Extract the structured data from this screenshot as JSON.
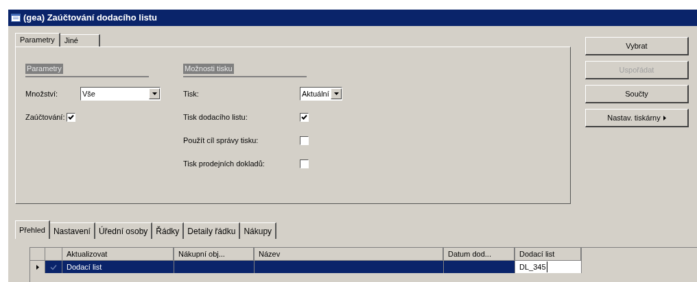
{
  "window": {
    "title": "(gea) Zaúčtování dodacího listu"
  },
  "top_tabs": [
    {
      "label": "Parametry",
      "selected": true
    },
    {
      "label": "Jiné",
      "selected": false
    }
  ],
  "groups": [
    {
      "title": "Parametry",
      "fields": [
        {
          "kind": "select",
          "label": "Množství:",
          "value": "Vše"
        },
        {
          "kind": "checkbox",
          "label": "Zaúčtování:",
          "checked": true
        }
      ]
    },
    {
      "title": "Možnosti tisku",
      "fields": [
        {
          "kind": "select",
          "label": "Tisk:",
          "value": "Aktuální"
        },
        {
          "kind": "checkbox",
          "label": "Tisk dodacího listu:",
          "checked": true
        },
        {
          "kind": "checkbox",
          "label": "Použít cíl správy tisku:",
          "checked": false
        },
        {
          "kind": "checkbox",
          "label": "Tisk prodejních dokladů:",
          "checked": false
        }
      ]
    }
  ],
  "buttons": [
    {
      "label": "Vybrat",
      "disabled": false,
      "menu": false
    },
    {
      "label": "Uspořádat",
      "disabled": true,
      "menu": false
    },
    {
      "label": "Součty",
      "disabled": false,
      "menu": false
    },
    {
      "label": "Nastav. tiskárny",
      "disabled": false,
      "menu": true
    }
  ],
  "bottom_tabs": [
    {
      "label": "Přehled",
      "selected": true
    },
    {
      "label": "Nastavení",
      "selected": false
    },
    {
      "label": "Úřední osoby",
      "selected": false
    },
    {
      "label": "Řádky",
      "selected": false
    },
    {
      "label": "Detaily řádku",
      "selected": false
    },
    {
      "label": "Nákupy",
      "selected": false
    }
  ],
  "table": {
    "columns": [
      "Aktualizovat",
      "Nákupní obj...",
      "Název",
      "Datum dod...",
      "Dodací list"
    ],
    "rows": [
      {
        "selected": true,
        "checked": true,
        "cells": [
          "Dodací list",
          "",
          "",
          "",
          "DL_345"
        ]
      }
    ]
  }
}
